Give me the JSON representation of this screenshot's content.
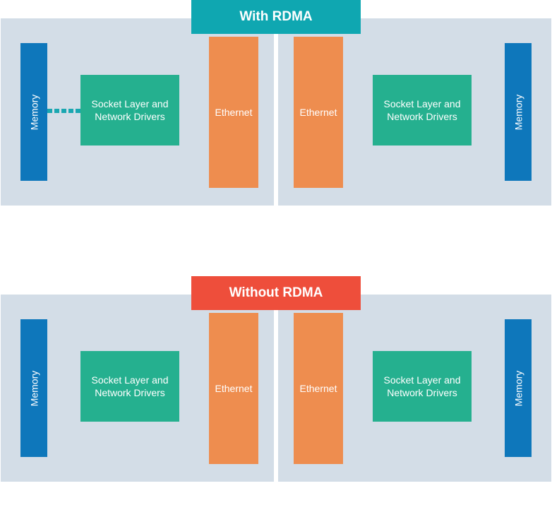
{
  "colors": {
    "title_with": "#0fa7b1",
    "title_without": "#ee4e3b",
    "panel_bg": "#d3dde7",
    "memory": "#0e77bb",
    "socket": "#25b08f",
    "ethernet": "#ee8d4f"
  },
  "diagrams": {
    "with_rdma": {
      "title": "With RDMA",
      "left": {
        "memory": "Memory",
        "socket": "Socket Layer and Network Drivers",
        "ethernet": "Ethernet"
      },
      "right": {
        "memory": "Memory",
        "socket": "Socket Layer and Network Drivers",
        "ethernet": "Ethernet"
      }
    },
    "without_rdma": {
      "title": "Without RDMA",
      "left": {
        "memory": "Memory",
        "socket": "Socket Layer and Network Drivers",
        "ethernet": "Ethernet"
      },
      "right": {
        "memory": "Memory",
        "socket": "Socket Layer and Network Drivers",
        "ethernet": "Ethernet"
      }
    }
  }
}
